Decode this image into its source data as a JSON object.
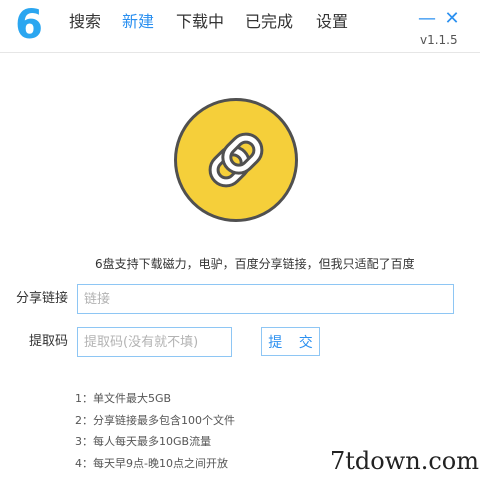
{
  "app": {
    "logo": "6",
    "version": "v1.1.5",
    "accent_color": "#2b90f0"
  },
  "nav": {
    "tabs": [
      {
        "label": "搜索",
        "active": false
      },
      {
        "label": "新建",
        "active": true
      },
      {
        "label": "下载中",
        "active": false
      },
      {
        "label": "已完成",
        "active": false
      },
      {
        "label": "设置",
        "active": false
      }
    ]
  },
  "window": {
    "minimize_label": "—",
    "close_label": "✕"
  },
  "main": {
    "hero_icon": "link-icon",
    "hero_color": "#f5cf3a",
    "info": "6盘支持下载磁力，电驴，百度分享链接，但我只适配了百度",
    "share_link": {
      "label": "分享链接",
      "value": "",
      "placeholder": "链接"
    },
    "extract_code": {
      "label": "提取码",
      "value": "",
      "placeholder": "提取码(没有就不填)"
    },
    "submit_label": "提 交",
    "rules": [
      "1：单文件最大5GB",
      "2：分享链接最多包含100个文件",
      "3：每人每天最多10GB流量",
      "4：每天早9点-晚10点之间开放"
    ]
  },
  "watermark": "7tdown.com"
}
